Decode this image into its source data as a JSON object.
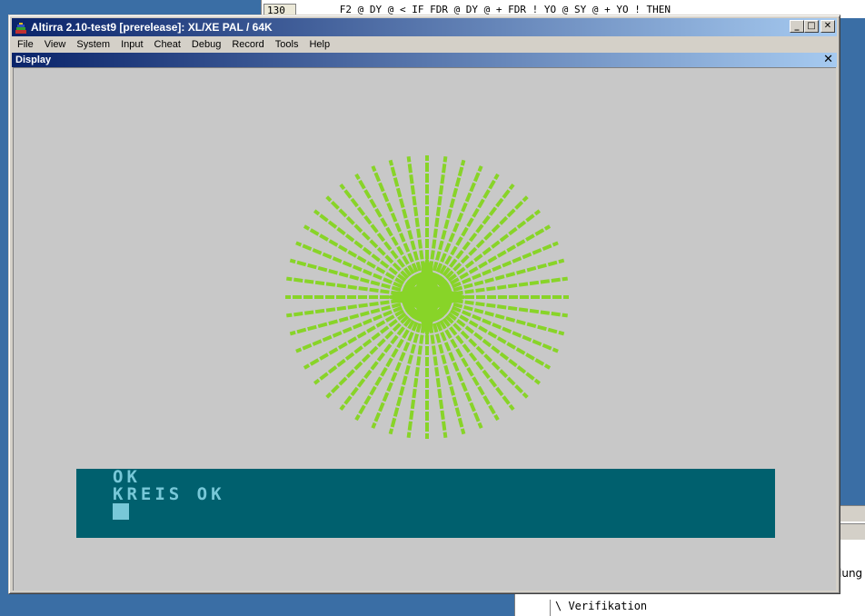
{
  "background": {
    "editor_line_number": "130",
    "editor_code_line": "      F2 @ DY @ < IF FDR @ DY @ + FDR ! YO @ SY @ + YO ! THEN",
    "lower_trail_text": "lung",
    "lower_code_line": "\\ Verifikation"
  },
  "window": {
    "title": "Altirra 2.10-test9 [prerelease]: XL/XE PAL / 64K",
    "buttons": {
      "minimize": "_",
      "maximize": "□",
      "close": "✕"
    }
  },
  "menu": {
    "items": [
      "File",
      "View",
      "System",
      "Input",
      "Cheat",
      "Debug",
      "Record",
      "Tools",
      "Help"
    ]
  },
  "pane": {
    "title": "Display",
    "close": "✕"
  },
  "screen": {
    "lines": [
      "OK",
      "KREIS OK"
    ],
    "colors": {
      "screen_bg": "#c8c8c8",
      "burst": "#88d428",
      "text_window_bg": "#00606e",
      "text_fg": "#78c8d8"
    }
  }
}
